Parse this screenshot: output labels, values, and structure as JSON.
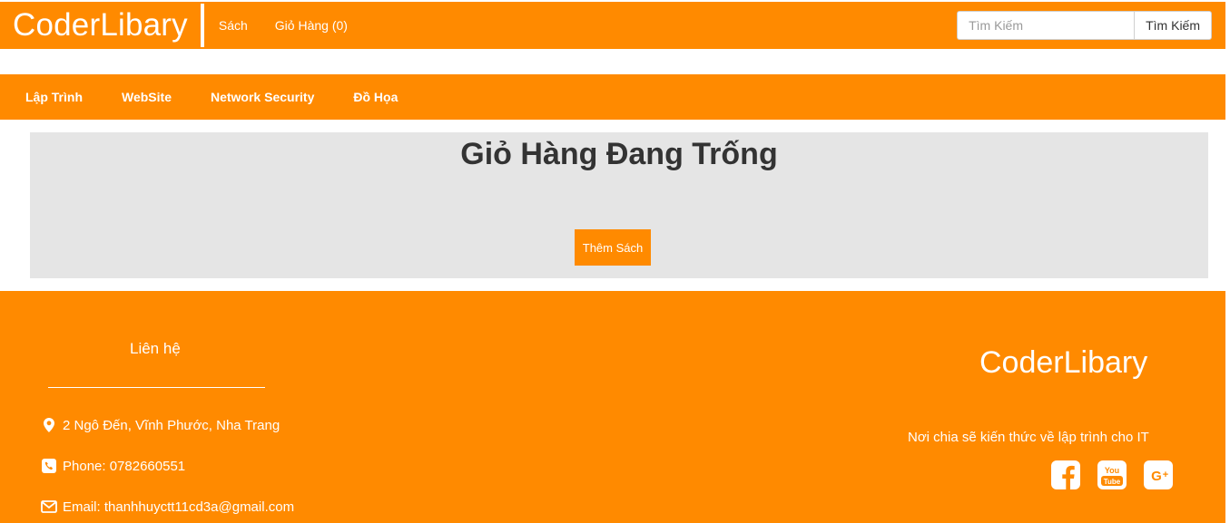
{
  "header": {
    "brand": "CoderLibary",
    "nav": [
      {
        "label": "Sách"
      },
      {
        "label": "Giỏ Hàng (0)"
      }
    ],
    "search": {
      "placeholder": "Tìm Kiếm",
      "button_label": "Tìm Kiếm"
    }
  },
  "categories": [
    {
      "label": "Lập Trình"
    },
    {
      "label": "WebSite"
    },
    {
      "label": "Network Security"
    },
    {
      "label": "Đồ Họa"
    }
  ],
  "cart": {
    "title": "Giỏ Hàng Đang Trống",
    "add_button": "Thêm Sách"
  },
  "footer": {
    "contact_title": "Liên hệ",
    "address": "2 Ngô Đến, Vĩnh Phước, Nha Trang",
    "phone": "Phone: 0782660551",
    "email": "Email: thanhhuyctt11cd3a@gmail.com",
    "brand": "CoderLibary",
    "tagline": "Nơi chia sẽ kiến thức về lập trình cho IT",
    "social_icons": [
      "facebook-icon",
      "youtube-icon",
      "google-plus-icon"
    ]
  },
  "colors": {
    "accent": "#ff8a00",
    "panel": "#e5e5e5"
  }
}
